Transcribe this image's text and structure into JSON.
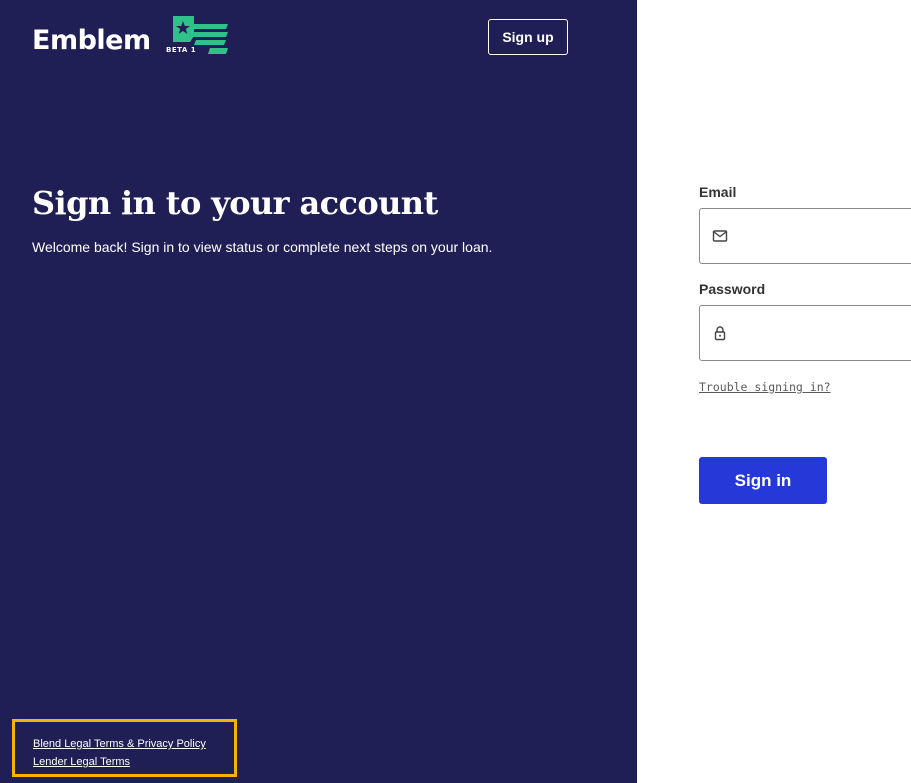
{
  "brand": {
    "name": "Emblem",
    "beta_label": "BETA 1",
    "colors": {
      "panel_bg": "#1f1f55",
      "accent_green": "#2ec28a",
      "primary_button": "#2439d8",
      "highlight_border": "#f5b300"
    }
  },
  "header": {
    "signup_label": "Sign up"
  },
  "hero": {
    "title": "Sign in to your account",
    "subtitle": "Welcome back! Sign in to view status or complete next steps on your loan."
  },
  "footer": {
    "links": [
      "Blend Legal Terms & Privacy Policy",
      "Lender Legal Terms"
    ]
  },
  "form": {
    "email": {
      "label": "Email",
      "value": "",
      "placeholder": "",
      "icon": "mail-icon"
    },
    "password": {
      "label": "Password",
      "value": "",
      "placeholder": "",
      "icon": "lock-icon"
    },
    "trouble_link": "Trouble signing in?",
    "submit_label": "Sign in"
  }
}
